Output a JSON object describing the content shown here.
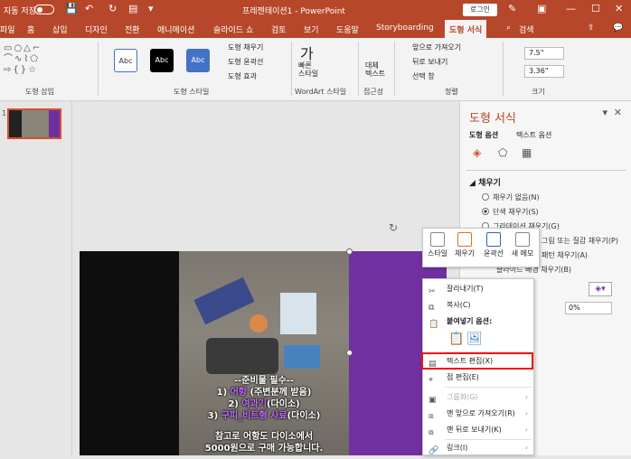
{
  "titlebar": {
    "autosave": "자동 저장",
    "title": "프레젠테이션1 - PowerPoint",
    "login": "로그인"
  },
  "tabs": [
    "파일",
    "홈",
    "삽입",
    "디자인",
    "전환",
    "애니메이션",
    "슬라이드 쇼",
    "검토",
    "보기",
    "도움말",
    "Storyboarding",
    "도형 서식",
    "검색"
  ],
  "ribbon": {
    "groups": {
      "insert": "도형 삽입",
      "style": "도형 스타일",
      "wordart": "WordArt 스타일",
      "access": "접근성",
      "arrange": "정렬",
      "size": "크기"
    },
    "style_samples": [
      "Abc",
      "Abc",
      "Abc"
    ],
    "fill": "도형 채우기",
    "outline": "도형 윤곽선",
    "effect": "도형 효과",
    "quick_style": "빠른\n스타일",
    "alt_text": "대체\n텍스트",
    "bring_forward": "앞으로 가져오기",
    "send_backward": "뒤로 보내기",
    "selection_pane": "선택 창",
    "height": "7.5\"",
    "width": "3.36\""
  },
  "slide_num": "1",
  "caption": {
    "l1": "--준비물 필수--",
    "l2a": "1) ",
    "l2b": "어항",
    "l2c": " (주변분께 받음)",
    "l3a": "2) ",
    "l3b": "여과기",
    "l3c": "(다이소)",
    "l4a": "3) ",
    "l4b": "구피_비트형 사료",
    "l4c": "(다이소)",
    "l5": "참고로 어항도 다이소에서",
    "l6": "5000원으로 구매 가능합니다."
  },
  "panel": {
    "title": "도형 서식",
    "tab1": "도형 옵션",
    "tab2": "텍스트 옵션",
    "section": "채우기",
    "opt_none": "채우기 없음(N)",
    "opt_solid": "단색 채우기(S)",
    "opt_grad": "그라데이션 채우기(G)",
    "opt_pic": "그림 또는 질감 채우기(P)",
    "opt_pattern": "패턴 채우기(A)",
    "opt_bg": "슬라이드 배경 채우기(B)",
    "transparency": "0%"
  },
  "mini": {
    "style": "스타일",
    "fill": "채우기",
    "outline": "윤곽선",
    "memo": "새 메모"
  },
  "menu": {
    "cut": "잘라내기(T)",
    "copy": "복사(C)",
    "paste_opts": "붙여넣기 옵션:",
    "edit_text": "텍스트 편집(X)",
    "edit_points": "점 편집(E)",
    "group": "그룹화(G)",
    "bring_front": "맨 앞으로 가져오기(R)",
    "send_back": "맨 뒤로 보내기(K)",
    "link": "링크(I)"
  }
}
